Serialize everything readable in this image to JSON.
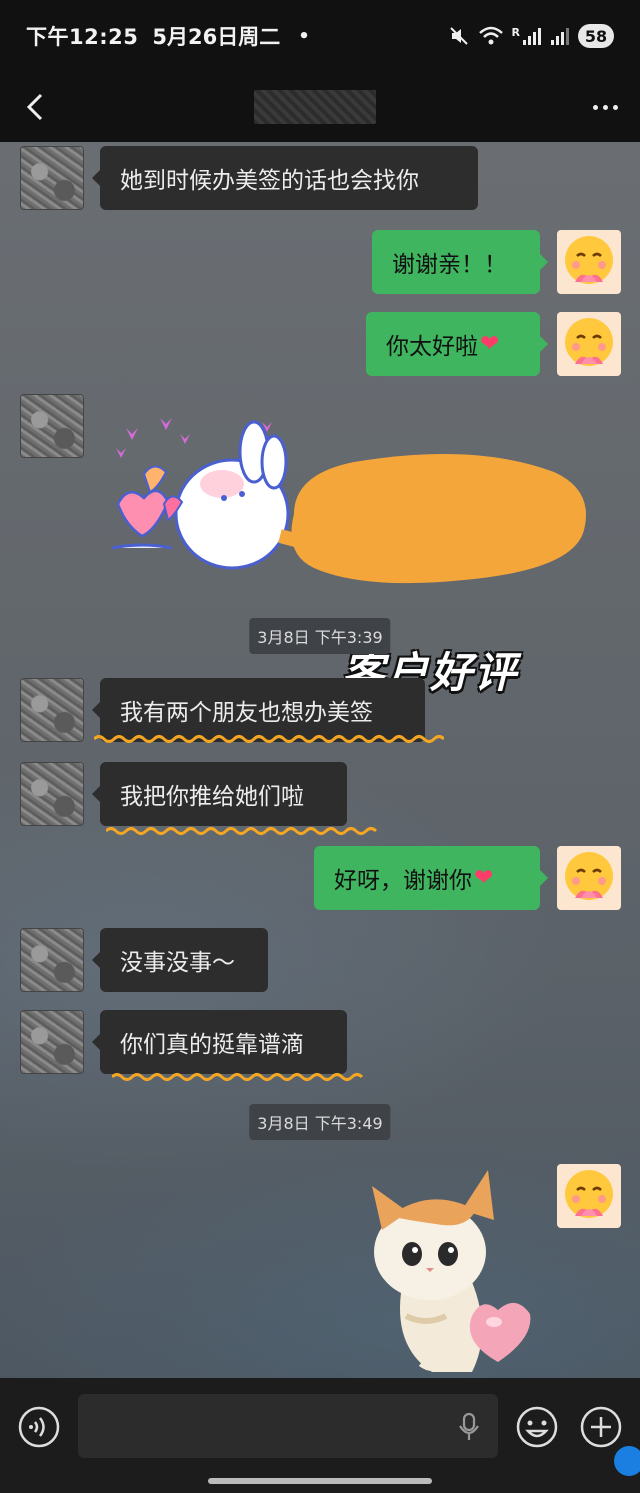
{
  "status_bar": {
    "time": "下午12:25",
    "date": "5月26日周二",
    "dot": "•",
    "signal_label": "R",
    "battery": "58"
  },
  "nav": {
    "title": ""
  },
  "messages": {
    "m1": "她到时候办美签的话也会找你",
    "m2": "谢谢亲！！",
    "m3": "你太好啦",
    "badge": "客户好评",
    "ts1": "3月8日 下午3:39",
    "m4": "我有两个朋友也想办美签",
    "m5": "我把你推给她们啦",
    "m6": "好呀，谢谢你",
    "m7": "没事没事～",
    "m8": "你们真的挺靠谱滴",
    "ts2": "3月8日 下午3:49"
  },
  "icons": {
    "back": "back-chevron-icon",
    "more": "more-dots-icon",
    "voice": "voice-input-icon",
    "mic": "microphone-icon",
    "emoji": "emoji-icon",
    "plus": "add-icon",
    "heart": "heart-emoji-icon"
  },
  "colors": {
    "outgoing_bubble": "#3fb55f",
    "incoming_bubble": "#2d2d2d",
    "squiggle": "#f5a623",
    "badge_bg": "#f4a63b"
  }
}
